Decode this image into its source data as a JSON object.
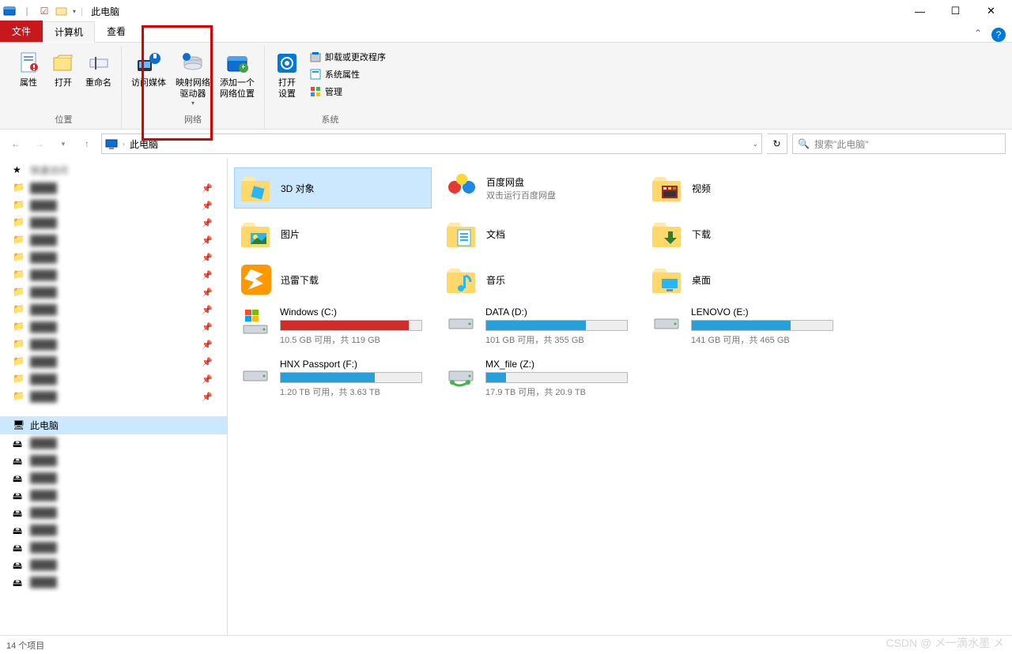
{
  "title": "此电脑",
  "tabs": {
    "file": "文件",
    "computer": "计算机",
    "view": "查看"
  },
  "ribbon": {
    "location": {
      "label": "位置",
      "props": "属性",
      "open": "打开",
      "rename": "重命名"
    },
    "network": {
      "label": "网络",
      "media": "访问媒体",
      "map": "映射网络\n驱动器",
      "addloc": "添加一个\n网络位置"
    },
    "system": {
      "label": "系统",
      "opensettings": "打开\n设置",
      "uninstall": "卸载或更改程序",
      "sysprops": "系统属性",
      "manage": "管理"
    }
  },
  "address": {
    "crumb": "此电脑"
  },
  "search": {
    "placeholder": "搜索\"此电脑\""
  },
  "folders": [
    {
      "name": "3D 对象",
      "sub": "",
      "icon": "3d"
    },
    {
      "name": "百度网盘",
      "sub": "双击运行百度网盘",
      "icon": "baidu"
    },
    {
      "name": "视频",
      "sub": "",
      "icon": "video"
    },
    {
      "name": "图片",
      "sub": "",
      "icon": "picture"
    },
    {
      "name": "文档",
      "sub": "",
      "icon": "document"
    },
    {
      "name": "下载",
      "sub": "",
      "icon": "download"
    },
    {
      "name": "迅雷下载",
      "sub": "",
      "icon": "xunlei"
    },
    {
      "name": "音乐",
      "sub": "",
      "icon": "music"
    },
    {
      "name": "桌面",
      "sub": "",
      "icon": "desktop"
    }
  ],
  "drives": [
    {
      "name": "Windows (C:)",
      "sub": "10.5 GB 可用，共 119 GB",
      "fill": 91,
      "color": "#d12c2c",
      "icon": "winlogo"
    },
    {
      "name": "DATA (D:)",
      "sub": "101 GB 可用，共 355 GB",
      "fill": 71,
      "color": "#26a0da",
      "icon": "hdd"
    },
    {
      "name": "LENOVO (E:)",
      "sub": "141 GB 可用，共 465 GB",
      "fill": 70,
      "color": "#26a0da",
      "icon": "hdd"
    },
    {
      "name": "HNX Passport (F:)",
      "sub": "1.20 TB 可用，共 3.63 TB",
      "fill": 67,
      "color": "#26a0da",
      "icon": "hdd"
    },
    {
      "name": "MX_file (Z:)",
      "sub": "17.9 TB 可用，共 20.9 TB",
      "fill": 14,
      "color": "#26a0da",
      "icon": "netdrive"
    }
  ],
  "sidebar_pins": 13,
  "status": "14 个项目",
  "watermark": "CSDN @ メ一滴水墨 メ"
}
